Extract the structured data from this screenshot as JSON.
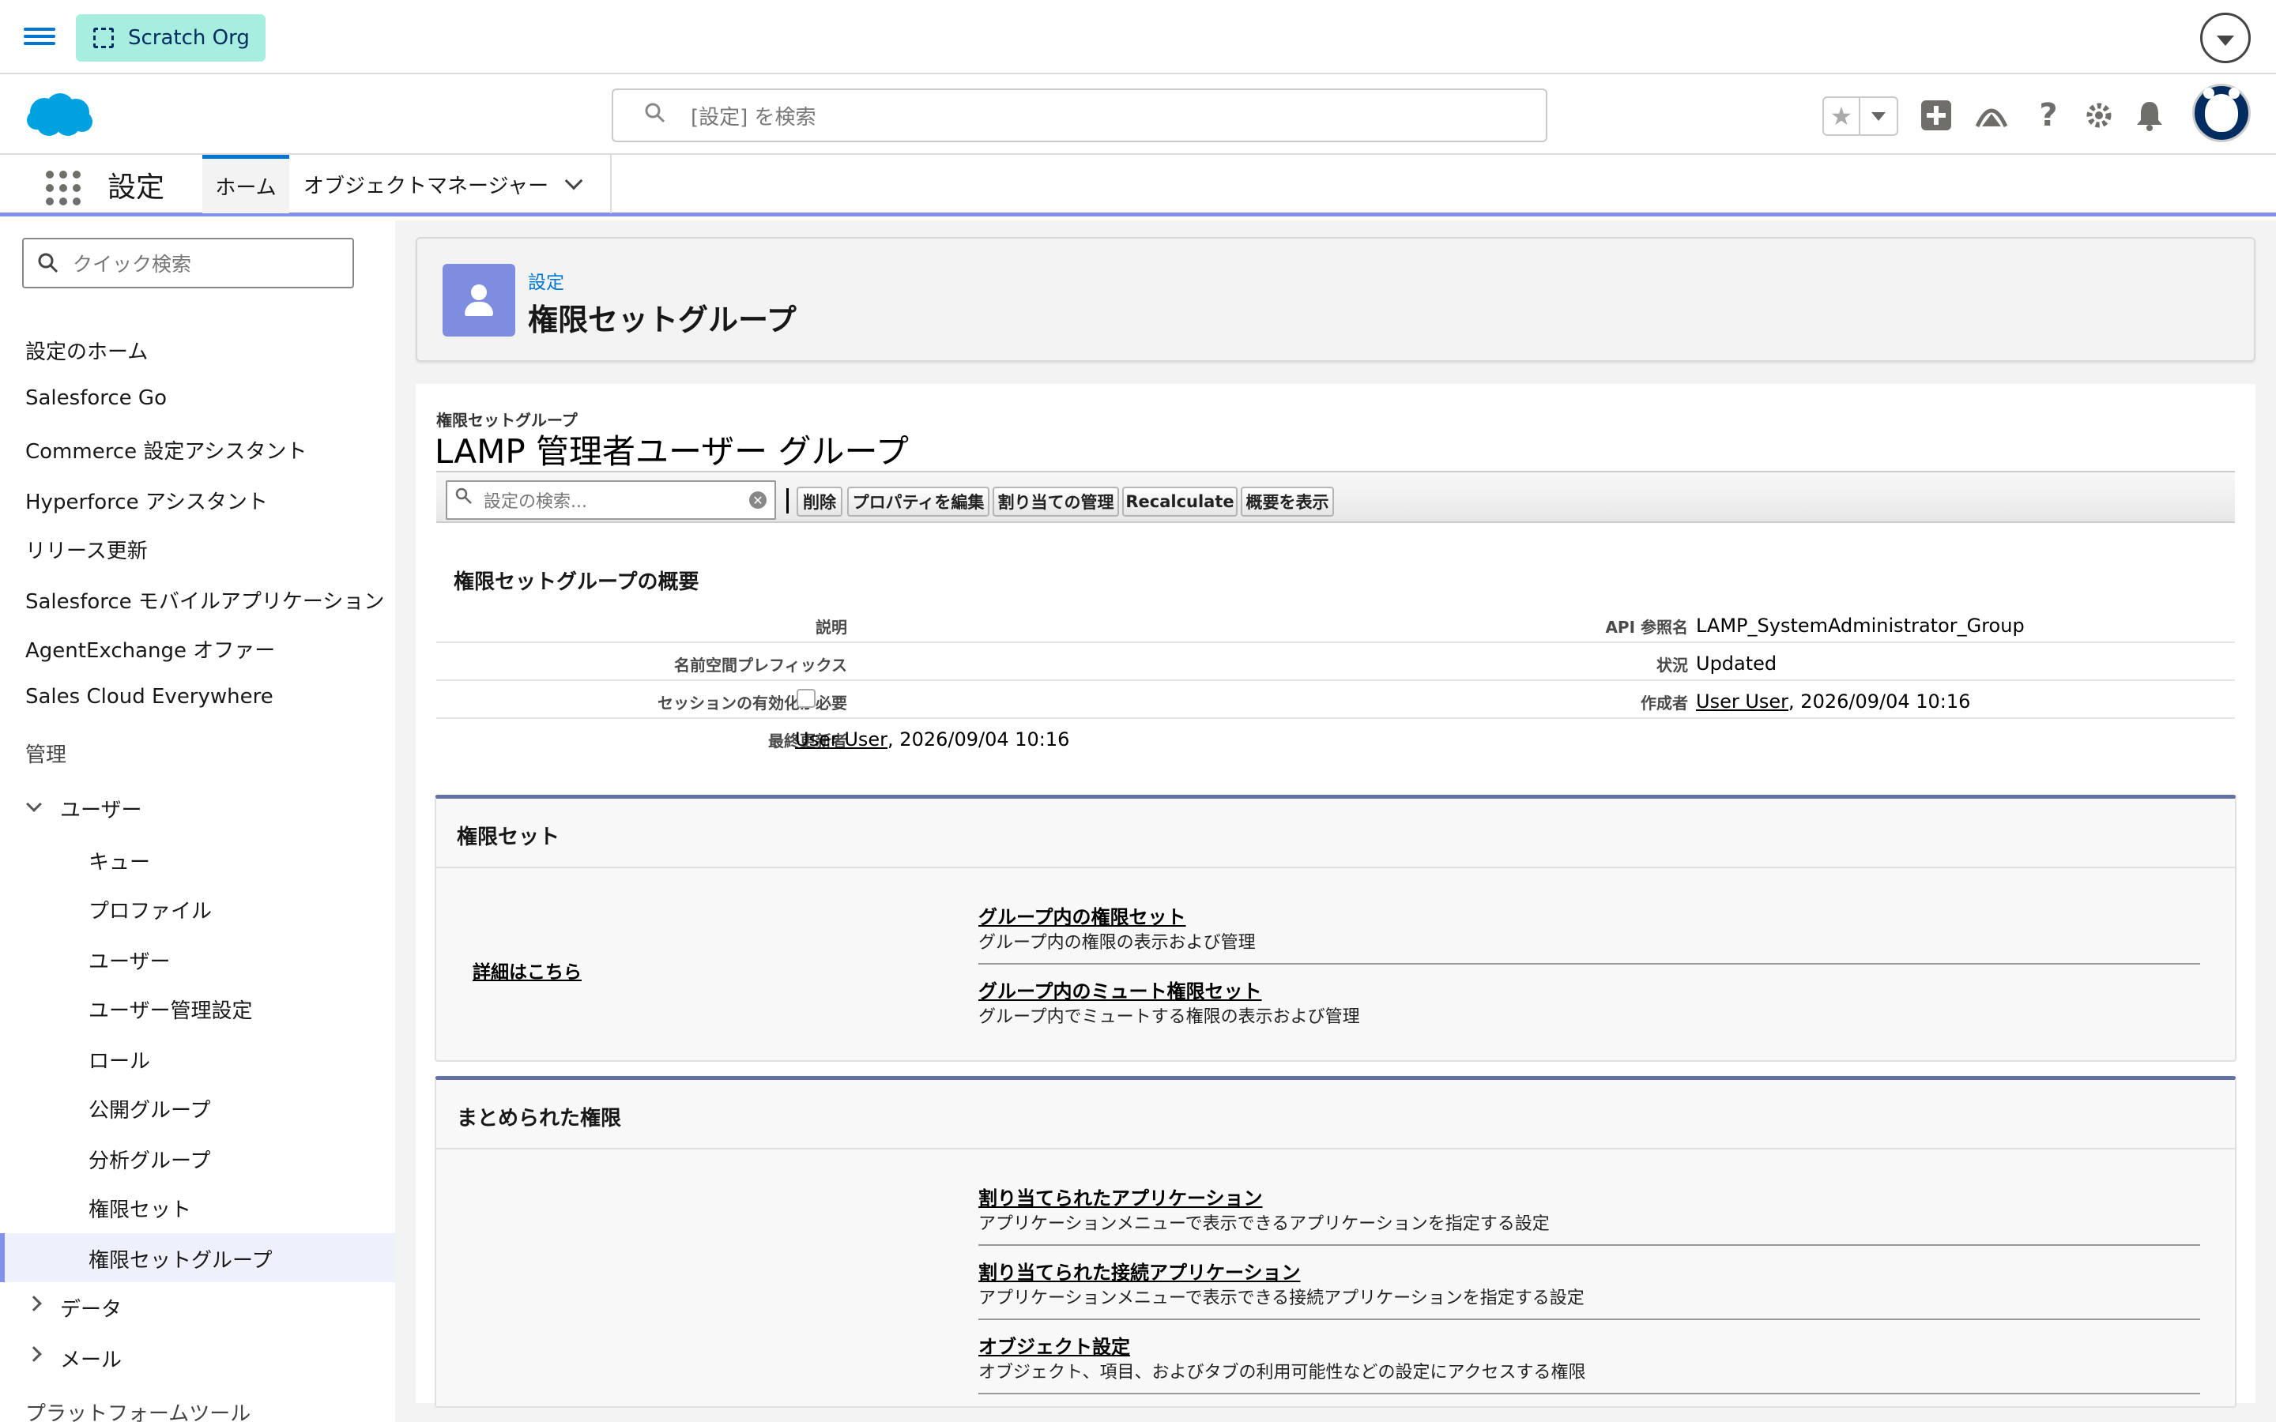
{
  "topbar": {
    "org_label": "Scratch Org"
  },
  "header": {
    "search_placeholder": "[設定] を検索"
  },
  "nav": {
    "app_name": "設定",
    "tabs": [
      {
        "label": "ホーム"
      },
      {
        "label": "オブジェクトマネージャー"
      }
    ]
  },
  "sidebar": {
    "quick_find_placeholder": "クイック検索",
    "items": [
      "設定のホーム",
      "Salesforce Go",
      "Commerce 設定アシスタント",
      "Hyperforce アシスタント",
      "リリース更新",
      "Salesforce モバイルアプリケーション",
      "AgentExchange オファー",
      "Sales Cloud Everywhere"
    ],
    "section_admin": "管理",
    "users_group": "ユーザー",
    "users_children": [
      "キュー",
      "プロファイル",
      "ユーザー",
      "ユーザー管理設定",
      "ロール",
      "公開グループ",
      "分析グループ",
      "権限セット",
      "権限セットグループ"
    ],
    "data_group": "データ",
    "mail_group": "メール",
    "platform_tools": "プラットフォームツール"
  },
  "page_header": {
    "breadcrumb": "設定",
    "title": "権限セットグループ"
  },
  "record": {
    "type_label": "権限セットグループ",
    "title": "LAMP 管理者ユーザー グループ",
    "search_placeholder": "設定の検索...",
    "buttons": [
      "削除",
      "プロパティを編集",
      "割り当ての管理",
      "Recalculate",
      "概要を表示"
    ]
  },
  "detail": {
    "title": "権限セットグループの概要",
    "left": [
      {
        "label": "説明",
        "value": ""
      },
      {
        "label": "名前空間プレフィックス",
        "value": ""
      },
      {
        "label": "セッションの有効化が必要",
        "value": ""
      },
      {
        "label": "最終更新者",
        "user": "User User",
        "date": ", 2026/09/04 10:16"
      }
    ],
    "right": [
      {
        "label": "API 参照名",
        "value": "LAMP_SystemAdministrator_Group"
      },
      {
        "label": "状況",
        "value": "Updated"
      },
      {
        "label": "作成者",
        "user": "User User",
        "date": ", 2026/09/04 10:16"
      }
    ]
  },
  "permission_sets_section": {
    "title": "権限セット",
    "learn_more": "詳細はこちら",
    "links": [
      {
        "title": "グループ内の権限セット",
        "desc": "グループ内の権限の表示および管理"
      },
      {
        "title": "グループ内のミュート権限セット",
        "desc": "グループ内でミュートする権限の表示および管理"
      }
    ]
  },
  "combined_section": {
    "title": "まとめられた権限",
    "links": [
      {
        "title": "割り当てられたアプリケーション",
        "desc": "アプリケーションメニューで表示できるアプリケーションを指定する設定"
      },
      {
        "title": "割り当てられた接続アプリケーション",
        "desc": "アプリケーションメニューで表示できる接続アプリケーションを指定する設定"
      },
      {
        "title": "オブジェクト設定",
        "desc": "オブジェクト、項目、およびタブの利用可能性などの設定にアクセスする権限"
      }
    ]
  },
  "colors": {
    "brand_blue": "#0176d3",
    "org_pill": "#a8eee0",
    "setup_icon": "#7f8de1",
    "nav_accent": "#8392e8"
  },
  "icons": [
    "menu-icon",
    "scratch-org-icon",
    "salesforce-cloud-logo",
    "search-icon",
    "star-icon",
    "add-icon",
    "trailhead-icon",
    "help-icon",
    "gear-icon",
    "bell-icon",
    "app-launcher-icon",
    "user-icon"
  ]
}
